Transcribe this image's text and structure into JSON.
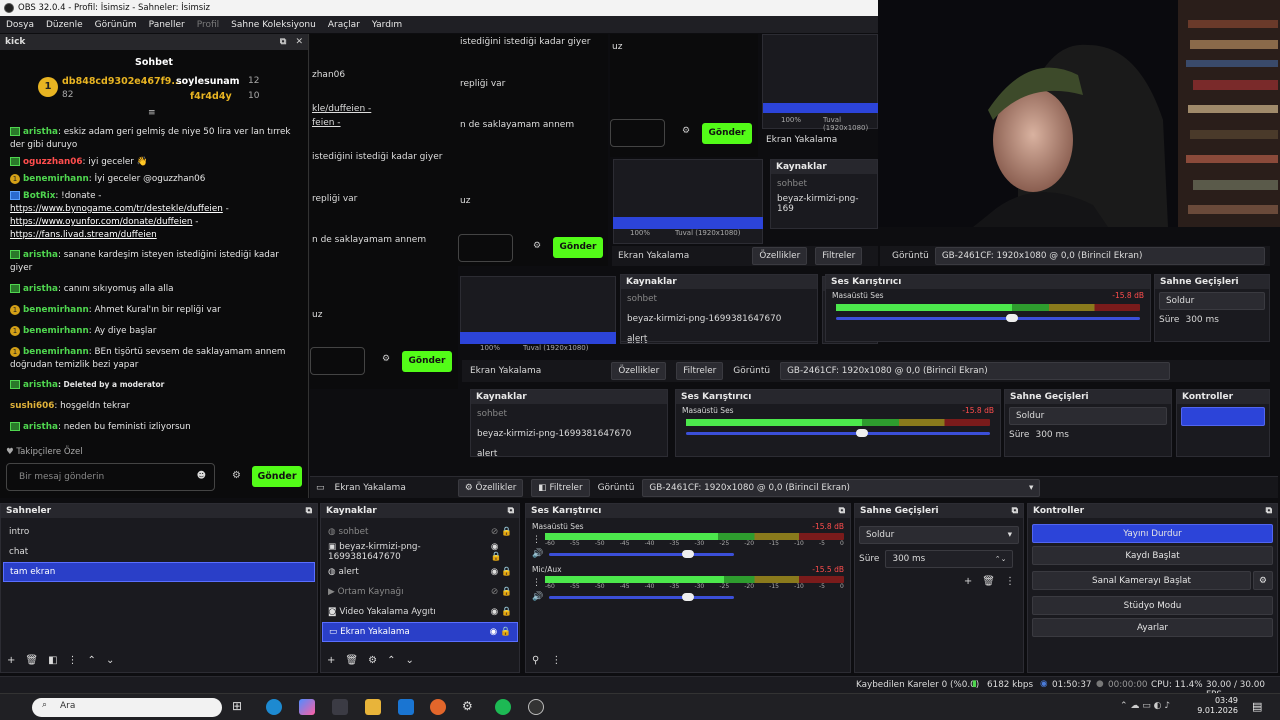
{
  "window": {
    "title": "OBS 32.0.4 - Profil: İsimsiz - Sahneler: İsimsiz"
  },
  "menu": [
    "Dosya",
    "Düzenle",
    "Görünüm",
    "Paneller",
    "Profil",
    "Sahne Koleksiyonu",
    "Araçlar",
    "Yardım"
  ],
  "chat_dock": {
    "dock_title": "kick",
    "header": "Sohbet",
    "leaders": [
      {
        "name": "db848cd9302e467f9...",
        "count": "82"
      },
      {
        "name": "soylesunam",
        "count": "12"
      },
      {
        "name": "f4r4d4y",
        "count": "10"
      }
    ],
    "messages": [
      {
        "user": "aristha",
        "text": ": eskiz adam geri gelmiş de niye 50 lira ver lan tırrek der gibi duruyo"
      },
      {
        "user": "oguzzhan06",
        "text": ": iyi geceler 👋"
      },
      {
        "user": "benemirhann",
        "text": ": İyi geceler @oguzzhan06"
      },
      {
        "user": "BotRix",
        "text": ": !donate -"
      },
      {
        "link1": "https://www.bynogame.com/tr/destekle/duffeien",
        "suffix1": " -"
      },
      {
        "link2": "https://www.oyunfor.com/donate/duffeien",
        "suffix2": " -"
      },
      {
        "link3": "https://fans.livad.stream/duffeien"
      },
      {
        "user": "aristha",
        "text": ": sanane kardeşim isteyen istediğini istediği kadar giyer"
      },
      {
        "user": "aristha",
        "text": ": canını sıkıyomuş alla alla"
      },
      {
        "user": "benemirhann",
        "text": ": Ahmet Kural'ın bir repliği var"
      },
      {
        "user": "benemirhann",
        "text": ": Ay diye başlar"
      },
      {
        "user": "benemirhann",
        "text": ": BEn tişörtü sevsem de saklayamam annem doğrudan temizlik bezi yapar"
      },
      {
        "user": "aristha",
        "text": ": Deleted by a moderator"
      },
      {
        "user": "sushi606",
        "text": ": hoşgeldn tekrar"
      },
      {
        "user": "aristha",
        "text": ": neden bu feministi izliyorsun"
      }
    ],
    "followers_mode": "Takipçilere Özel",
    "input_placeholder": "Bir mesaj gönderin",
    "send": "Gönder"
  },
  "mirror_texts": {
    "t1": "istediğini istediği kadar giyer",
    "t2": "zhan06",
    "t3": "kle/duffeien -",
    "t4": "feien -",
    "t5": "repliği var",
    "t6": "n de saklayamam annem",
    "t7": "uz",
    "t8": "Gönder",
    "t9": "Ekran Yakalama",
    "t10": "Kaynaklar",
    "t11": "sohbet",
    "t12": "beyaz-kirmizi-png-169",
    "t13": "100%",
    "t14": "Tuval (1920x1080)",
    "t15": "Özellikler",
    "t16": "Filtreler",
    "t17": "Görüntü",
    "t18": "GB-2461CF: 1920x1080 @ 0,0 (Birincil Ekran)",
    "t19": "Ses Karıştırıcı",
    "t20": "Masaüstü Ses",
    "t21": "-15.8 dB",
    "t22": "Sahne Geçişleri",
    "t23": "Soldur",
    "t24": "Süre",
    "t25": "300 ms",
    "t26": "Kontroller",
    "t27": "alert",
    "t28": "beyaz-kirmizi-png-1699381647670"
  },
  "toolbar": {
    "source": "Ekran Yakalama",
    "properties": "Özellikler",
    "filters": "Filtreler",
    "display_label": "Görüntü",
    "display_value": "GB-2461CF: 1920x1080 @ 0,0 (Birincil Ekran)"
  },
  "scenes": {
    "title": "Sahneler",
    "items": [
      "intro",
      "chat",
      "tam ekran"
    ],
    "selected": 2
  },
  "sources": {
    "title": "Kaynaklar",
    "items": [
      "sohbet",
      "beyaz-kirmizi-png-1699381647670",
      "alert",
      "Ortam Kaynağı",
      "Video Yakalama Aygıtı",
      "Ekran Yakalama"
    ]
  },
  "mixer": {
    "title": "Ses Karıştırıcı",
    "channels": [
      {
        "name": "Masaüstü Ses",
        "db": "-15.8 dB",
        "level": 0.58,
        "volume": 0.72
      },
      {
        "name": "Mic/Aux",
        "db": "-15.5 dB",
        "level": 0.6,
        "volume": 0.72
      }
    ],
    "ticks": [
      "-60",
      "-55",
      "-50",
      "-45",
      "-40",
      "-35",
      "-30",
      "-25",
      "-20",
      "-15",
      "-10",
      "-5",
      "0"
    ]
  },
  "transitions": {
    "title": "Sahne Geçişleri",
    "type": "Soldur",
    "duration_label": "Süre",
    "duration": "300 ms"
  },
  "controls": {
    "title": "Kontroller",
    "buttons": [
      "Yayını Durdur",
      "Kaydı Başlat",
      "Sanal Kamerayı Başlat",
      "Stüdyo Modu",
      "Ayarlar"
    ]
  },
  "status": {
    "dropped": "Kaybedilen Kareler 0 (%0.0)",
    "bitrate": "6182 kbps",
    "stream_time": "01:50:37",
    "rec_time": "00:00:00",
    "cpu": "CPU: 11.4%",
    "fps": "30.00 / 30.00 FPS"
  },
  "taskbar": {
    "search": "Ara",
    "time": "03:49",
    "date": "9.01.2026"
  },
  "colors": {
    "accent": "#2c44d9",
    "kick_green": "#53fc18"
  }
}
